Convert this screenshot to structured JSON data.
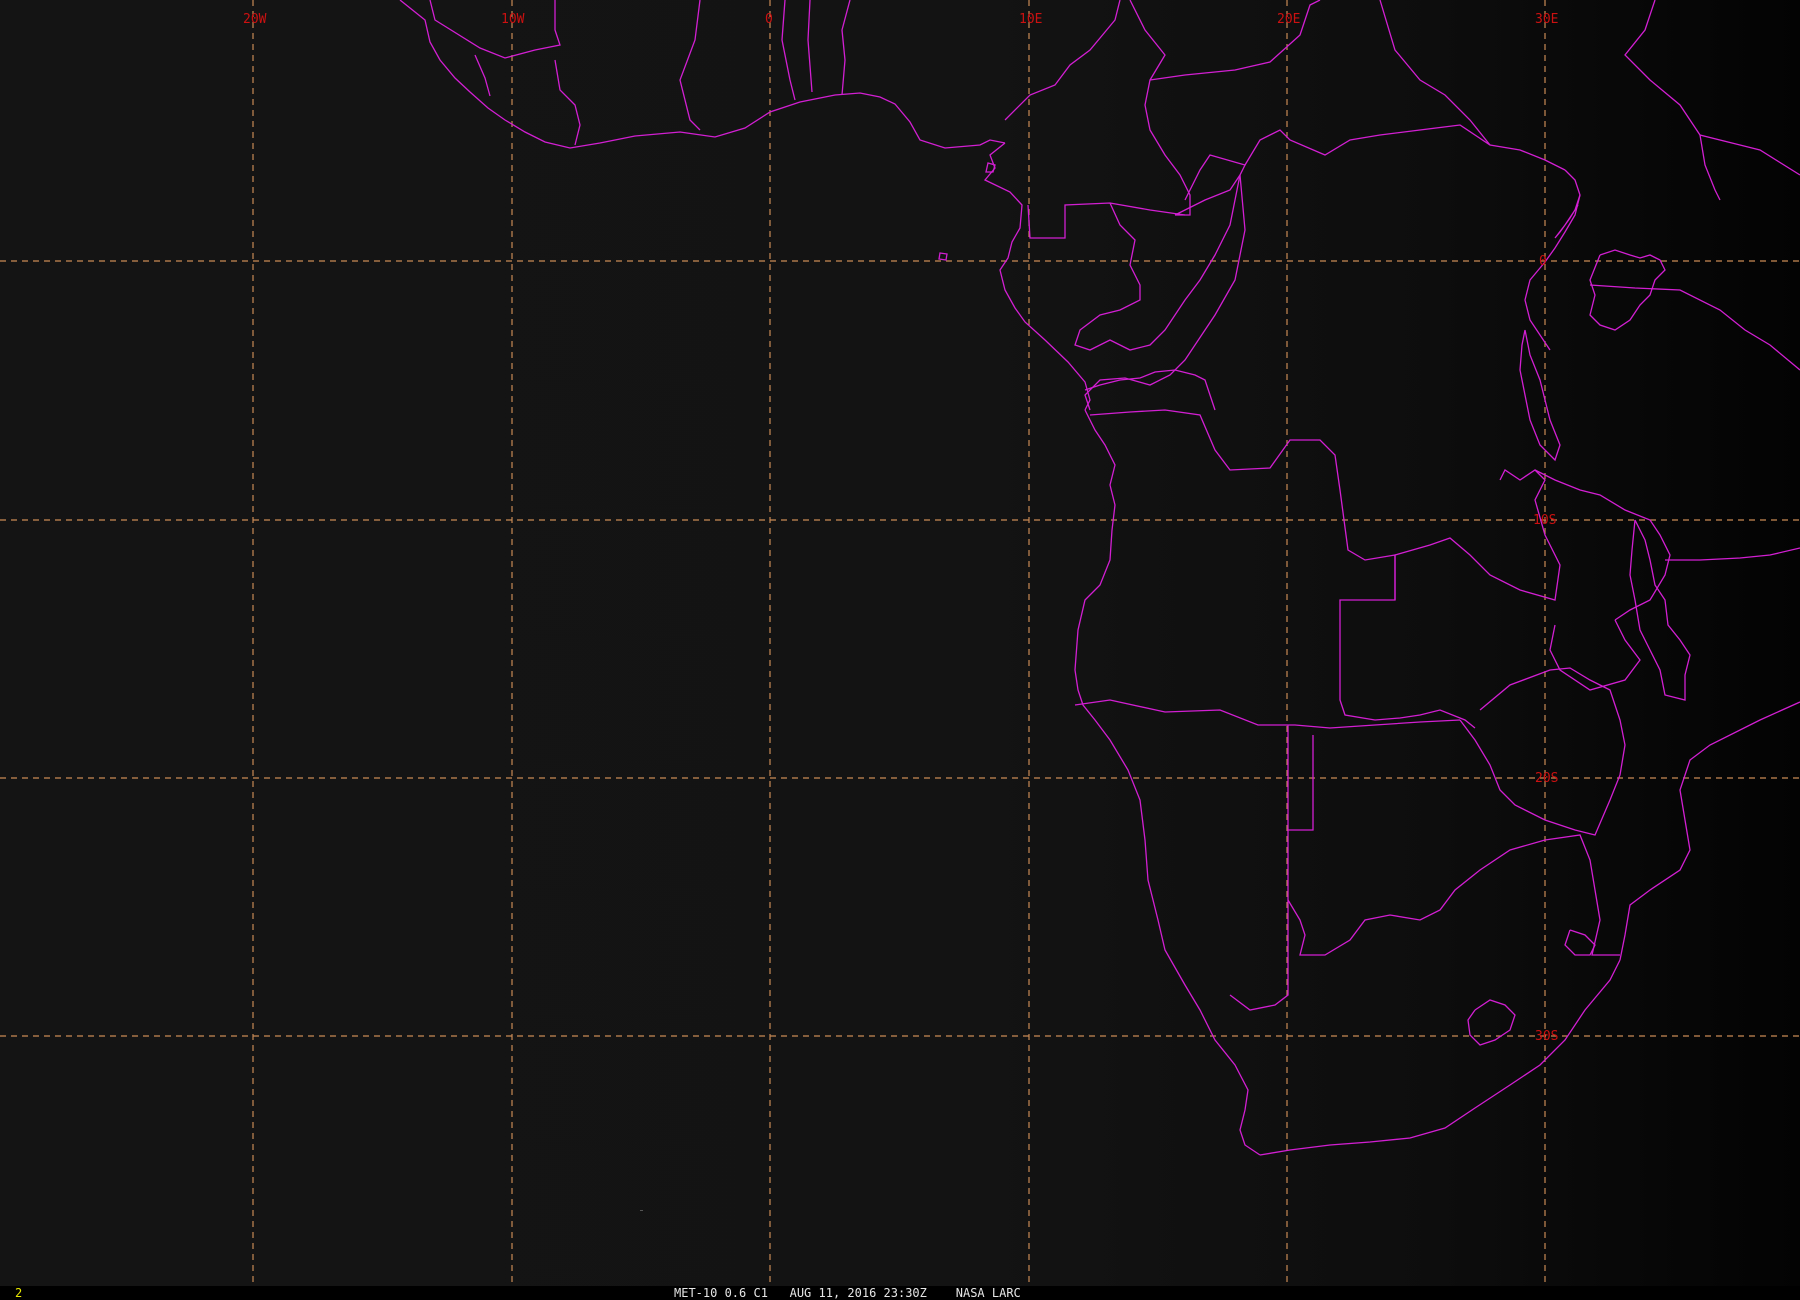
{
  "map": {
    "satellite": "MET-10",
    "channel": "0.6 C1",
    "projection_labels": {
      "longitudes": [
        "20W",
        "10W",
        "0",
        "10E",
        "20E",
        "30E"
      ],
      "latitudes": [
        "0",
        "10S",
        "20S",
        "30S"
      ]
    },
    "colors": {
      "background": "#141414",
      "coastline": "#d21fd2",
      "grid": "#c98a55",
      "grid_label": "#cc1111",
      "frame_number": "#e8e800",
      "caption": "#e6e6e6"
    }
  },
  "status": {
    "frame_number": "2",
    "caption": "MET-10 0.6 C1   AUG 11, 2016 23:30Z    NASA LARC"
  }
}
